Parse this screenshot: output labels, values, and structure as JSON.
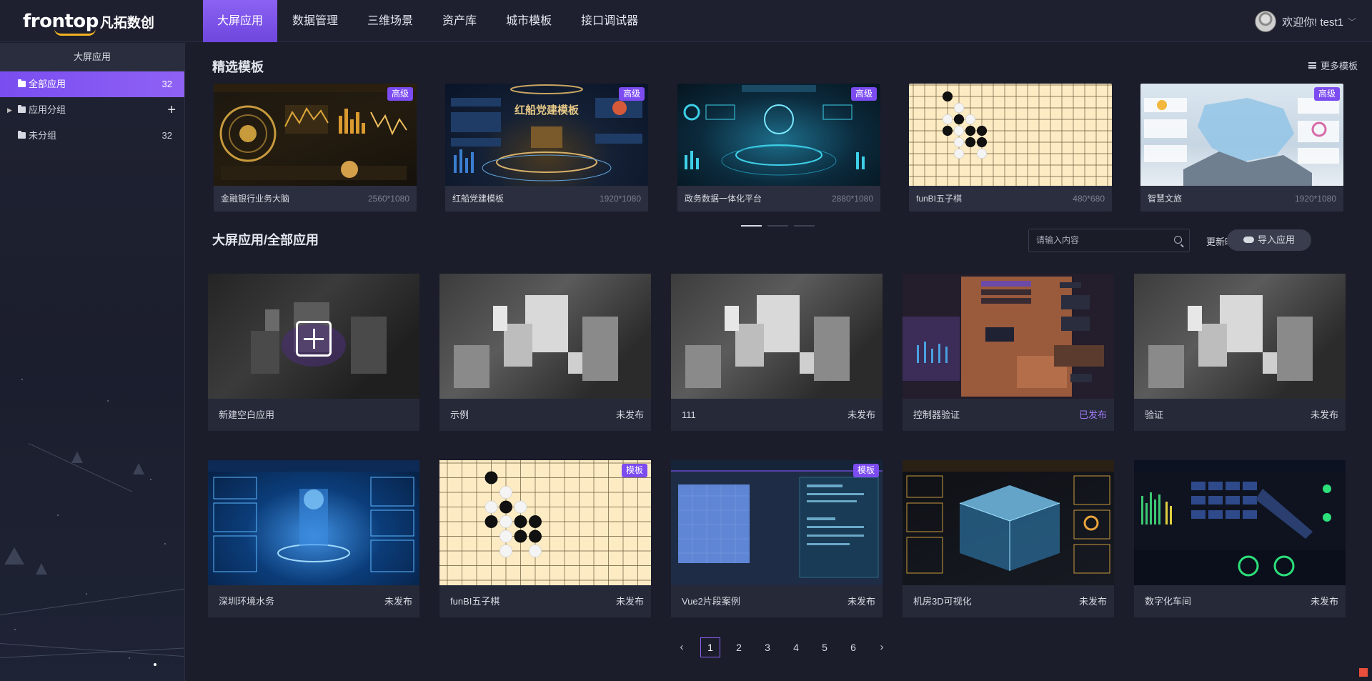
{
  "topbar": {
    "logo_text": "frontop",
    "logo_cn": "凡拓数创",
    "nav": [
      "大屏应用",
      "数据管理",
      "三维场景",
      "资产库",
      "城市模板",
      "接口调试器"
    ],
    "active_nav": 0,
    "user_greeting": "欢迎你! test1"
  },
  "sidebar": {
    "header": "大屏应用",
    "items": [
      {
        "label": "全部应用",
        "count": "32"
      },
      {
        "label": "应用分组",
        "count": ""
      },
      {
        "label": "未分组",
        "count": "32"
      }
    ]
  },
  "templates": {
    "title": "精选模板",
    "more": "更多模板",
    "items": [
      {
        "name": "金融银行业务大脑",
        "res": "2560*1080",
        "badge": "高级"
      },
      {
        "name": "红船党建模板",
        "res": "1920*1080",
        "badge": "高级"
      },
      {
        "name": "政务数据一体化平台",
        "res": "2880*1080",
        "badge": "高级"
      },
      {
        "name": "funBI五子棋",
        "res": "480*680",
        "badge": ""
      },
      {
        "name": "智慧文旅",
        "res": "1920*1080",
        "badge": "高级"
      }
    ],
    "thumb_text": {
      "hongchuan": "红船党建模板"
    }
  },
  "apps": {
    "title": "大屏应用/全部应用",
    "search_placeholder": "请输入内容",
    "sort_label": "更新时间",
    "import_label": "导入应用",
    "items": [
      {
        "name": "新建空白应用",
        "status": ""
      },
      {
        "name": "示例",
        "status": "未发布"
      },
      {
        "name": "111",
        "status": "未发布"
      },
      {
        "name": "控制器验证",
        "status": "已发布"
      },
      {
        "name": "验证",
        "status": "未发布"
      },
      {
        "name": "深圳环境水务",
        "status": "未发布"
      },
      {
        "name": "funBI五子棋",
        "status": "未发布",
        "badge": "模板"
      },
      {
        "name": "Vue2片段案例",
        "status": "未发布",
        "badge": "模板"
      },
      {
        "name": "机房3D可视化",
        "status": "未发布"
      },
      {
        "name": "数字化车间",
        "status": "未发布"
      }
    ]
  },
  "pager": {
    "pages": [
      "1",
      "2",
      "3",
      "4",
      "5",
      "6"
    ],
    "current": "1",
    "prev": "‹",
    "next": "›"
  },
  "colors": {
    "accent": "#7c4cf0",
    "published": "#a07cf6",
    "bg": "#1b1d2a"
  }
}
